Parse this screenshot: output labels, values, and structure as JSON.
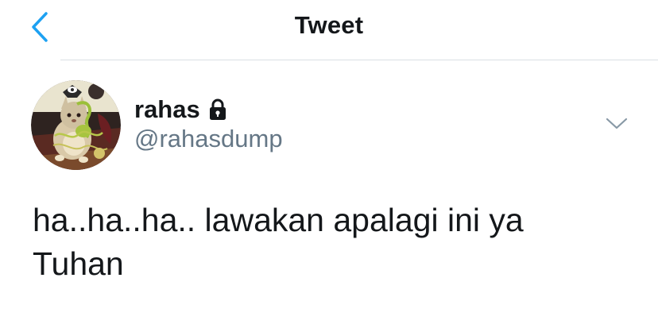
{
  "header": {
    "back_icon": "chevron-left-icon",
    "title": "Tweet"
  },
  "tweet": {
    "author": {
      "name": "rahas",
      "handle": "@rahasdump",
      "protected_icon": "lock-icon"
    },
    "menu_icon": "chevron-down-icon",
    "text_line1": "ha..ha..ha.. lawakan apalagi ini ya",
    "text_line2": "Tuhan"
  },
  "colors": {
    "accent": "#1da1f2",
    "text_primary": "#14171a",
    "text_secondary": "#657786",
    "divider": "#d9dfe4"
  }
}
